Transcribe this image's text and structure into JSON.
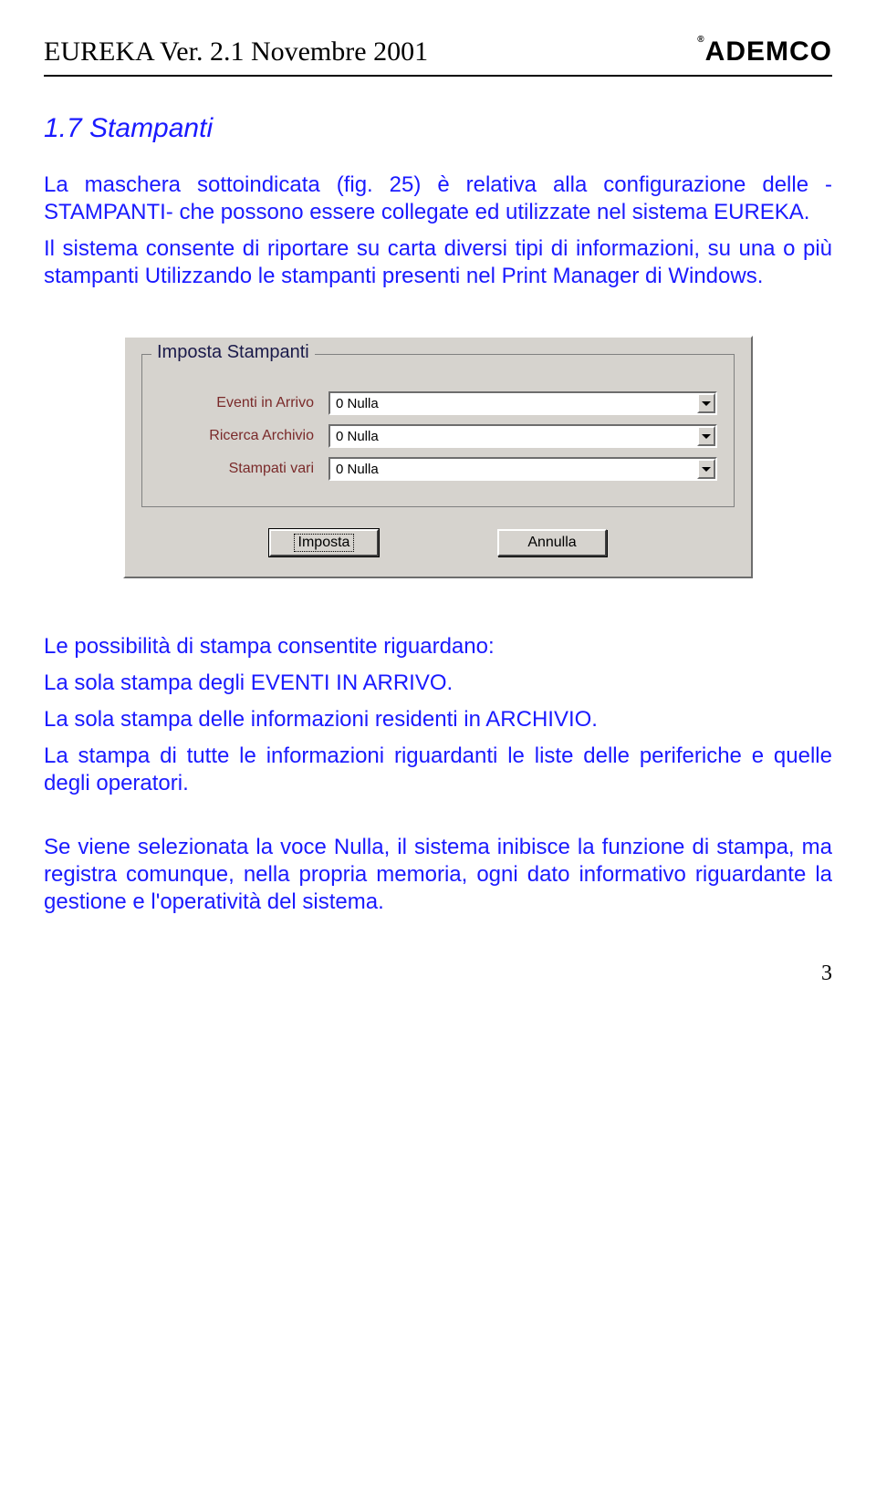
{
  "header": {
    "doc_title": "EUREKA Ver. 2.1 Novembre 2001",
    "brand": "ADEMCO",
    "reg": "®"
  },
  "section": {
    "title": "1.7 Stampanti",
    "p1": "La maschera sottoindicata (fig. 25) è relativa alla configurazione delle -STAMPANTI- che possono essere collegate ed utilizzate nel sistema EUREKA.",
    "p2": "Il sistema consente di riportare su carta diversi tipi di informazioni, su una o più stampanti Utilizzando le stampanti presenti nel Print Manager di Windows."
  },
  "dialog": {
    "group_title": "Imposta Stampanti",
    "fields": [
      {
        "label": "Eventi in Arrivo",
        "value": "0 Nulla"
      },
      {
        "label": "Ricerca Archivio",
        "value": "0 Nulla"
      },
      {
        "label": "Stampati vari",
        "value": "0 Nulla"
      }
    ],
    "btn_ok": "Imposta",
    "btn_cancel": "Annulla"
  },
  "after": {
    "p3": "Le possibilità di stampa consentite riguardano:",
    "p4": "La sola stampa degli EVENTI IN ARRIVO.",
    "p5": "La sola stampa delle informazioni residenti in ARCHIVIO.",
    "p6": "La stampa di tutte le informazioni riguardanti le liste delle periferiche e quelle degli operatori.",
    "p7": "Se viene selezionata la voce Nulla, il sistema inibisce la funzione di stampa, ma registra comunque, nella propria memoria, ogni dato informativo riguardante la gestione e l'operatività del sistema."
  },
  "page_number": "3"
}
